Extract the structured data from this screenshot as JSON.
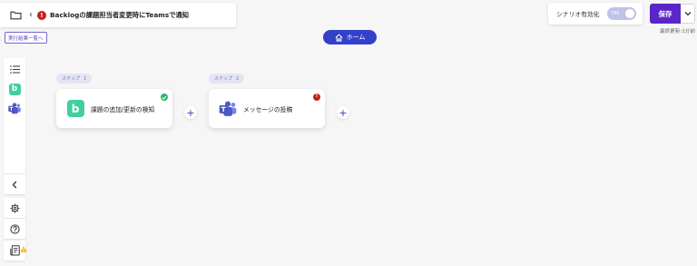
{
  "header": {
    "title": "Backlogの課題担当者変更時にTeamsで通知",
    "back_glyph": "‹",
    "error_glyph": "!",
    "icons": [
      "folder-icon",
      "chevron-left-icon",
      "error-icon"
    ]
  },
  "results_link": "実行結果一覧へ",
  "home": {
    "label": "ホーム",
    "icon": "home-icon"
  },
  "scenario_toggle": {
    "label": "シナリオ有効化",
    "state": "ON"
  },
  "save": {
    "label": "保存",
    "menu_icon": "chevron-down-icon"
  },
  "last_updated": "最終更新:1分前",
  "sidebar": {
    "items": [
      {
        "name": "list",
        "icon": "list-icon"
      },
      {
        "name": "backlog",
        "icon": "backlog-icon",
        "glyph": "b"
      },
      {
        "name": "teams",
        "icon": "teams-icon"
      }
    ],
    "collapse_icon": "chevron-left-icon",
    "bottom": [
      {
        "name": "settings",
        "icon": "gear-icon"
      },
      {
        "name": "help",
        "icon": "help-icon"
      },
      {
        "name": "guide",
        "icon": "document-icon",
        "badge": "warning-icon"
      }
    ]
  },
  "steps": [
    {
      "tag_label": "ステップ",
      "tag_number": "1",
      "label": "課題の追加/更新の検知",
      "app": "Backlog",
      "app_glyph": "b",
      "status": "success"
    },
    {
      "tag_label": "ステップ",
      "tag_number": "2",
      "label": "メッセージの投稿",
      "app": "Microsoft Teams",
      "status": "error",
      "status_glyph": "!"
    }
  ],
  "add_glyph": "+",
  "colors": {
    "primary": "#5b26c9",
    "home_pill": "#3340c9",
    "backlog": "#42ce9f",
    "teams": "#5059c9",
    "error": "#c91d21",
    "success": "#29b866",
    "toggle": "#bfc3e8"
  }
}
